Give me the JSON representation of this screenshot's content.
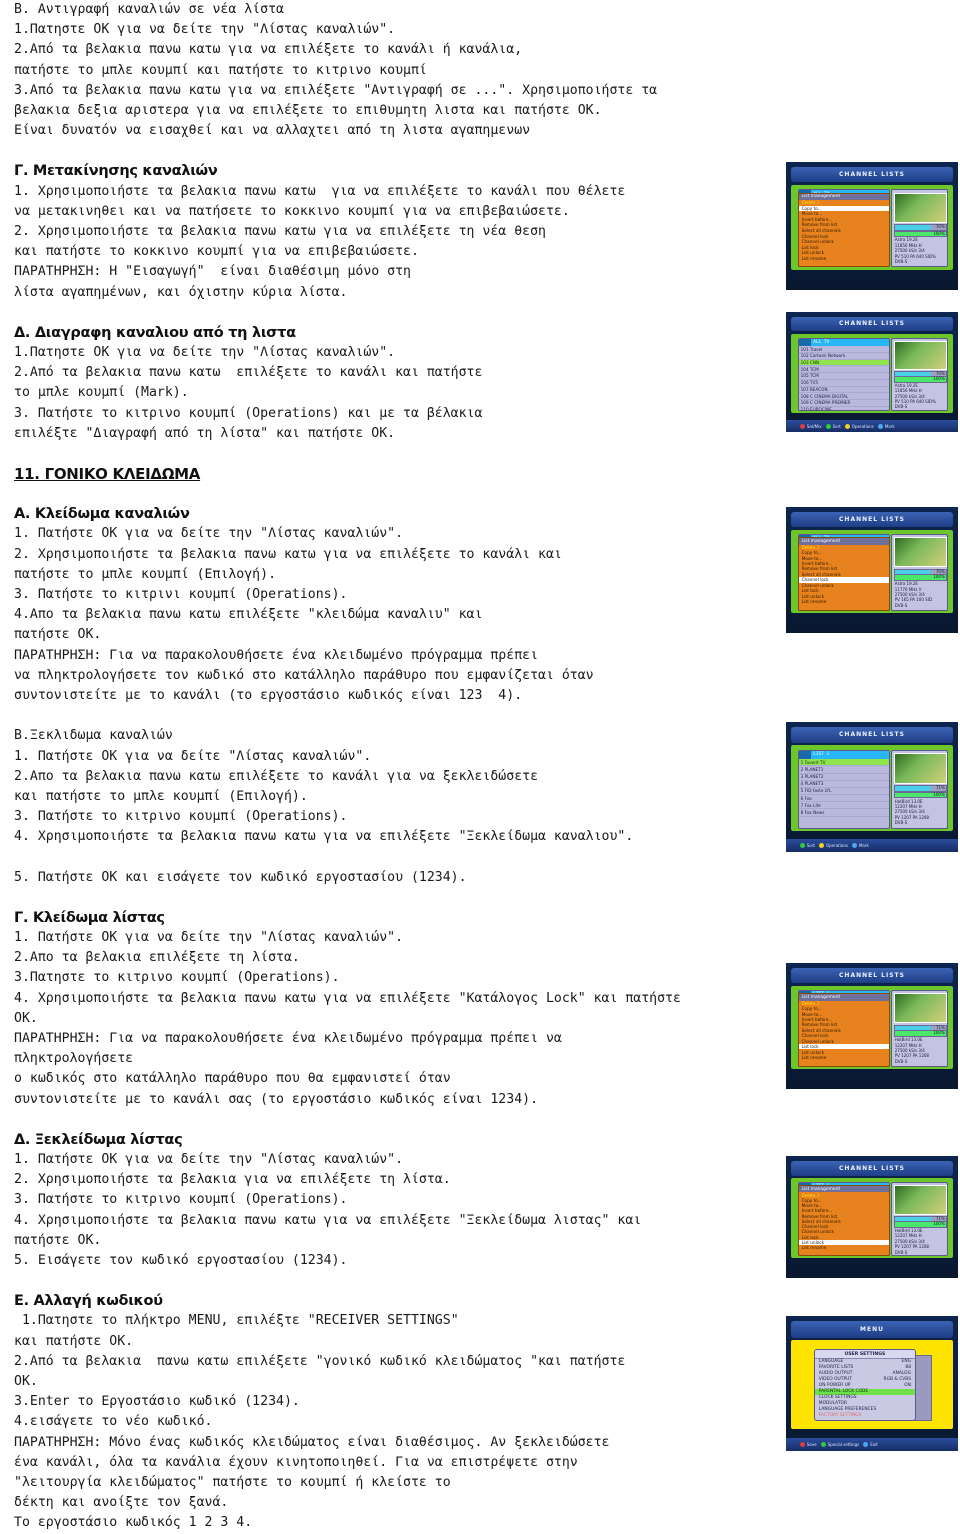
{
  "document": {
    "blocks": [
      {
        "type": "para",
        "text": "B. Αντιγραφή καναλιών σε νέα λίστα\n1.Πατηστε OK για να δείτε την \"Λίστας καναλιών\".\n2.Από τα βελακια πανω κατω για να επιλέξετε το κανάλι ή κανάλια,\nπατήστε το μπλε κουμπί και πατήστε το κιτρινο κουμπί\n3.Από τα βελακια πανω κατω για να επιλέξετε \"Αντιγραφή σε ...\". Χρησιμοποιήστε τα\nβελακια δεξια αριστερα για να επιλέξετε το επιθυμητη λιστα και πατήστε OK.\nΕίναι δυνατόν να εισαχθεί και να αλλαχτει από τη λιστα αγαπημενων"
      },
      {
        "type": "spacer"
      },
      {
        "type": "heading",
        "text": "Γ. Μετακίνησης καναλιών"
      },
      {
        "type": "para",
        "text": "1. Χρησιμοποιήστε τα βελακια πανω κατω  για να επιλέξετε το κανάλι που θέλετε\nνα μετακινηθει και να πατήσετε το κοκκινο κουμπί για να επιβεβαιώσετε.\n2. Χρησιμοποιήστε τα βελακια πανω κατω για να επιλέξετε τη νέα θεση\nκαι πατήστε το κοκκινο κουμπί για να επιβεβαιώσετε.\nΠΑΡΑΤΗΡΗΣΗ: Η \"Εισαγωγή\"  είναι διαθέσιμη μόνο στη\nλίστα αγαπημένων, και όχιστην κύρια λίστα."
      },
      {
        "type": "spacer"
      },
      {
        "type": "heading",
        "text": "Δ. Διαγραφη καναλιου από τη λιστα"
      },
      {
        "type": "para",
        "text": "1.Πατηστε OK για να δείτε την \"Λίστας καναλιών\".\n2.Από τα βελακια πανω κατω  επιλέξετε το κανάλι και πατήστε\nτο μπλε κουμπί (Mark).\n3. Πατήστε το κιτρινο κουμπί (Operations) και με τα βέλακια\nεπιλέξτε \"Διαγραφή από τη λίστα\" και πατήστε OK."
      },
      {
        "type": "spacer"
      },
      {
        "type": "heading",
        "numbered": true,
        "text": "11. ΓΟΝΙΚΟ ΚΛΕΙΔΩΜΑ"
      },
      {
        "type": "spacer"
      },
      {
        "type": "heading",
        "text": "Α. Κλείδωμα καναλιών"
      },
      {
        "type": "para",
        "text": "1. Πατήστε OK για να δείτε την \"Λίστας καναλιών\".\n2. Χρησιμοποιήστε τα βελακια πανω κατω για να επιλέξετε το κανάλι και\nπατήστε το μπλε κουμπί (Επιλογή).\n3. Πατήστε το κιτρινι κουμπί (Operations).\n4.Απο τα βελακια πανω κατω επιλέξετε \"κλειδώμα καναλιυ\" και\nπατήστε OK.\nΠΑΡΑΤΗΡΗΣΗ: Για να παρακολουθήσετε ένα κλειδωμένο πρόγραμμα πρέπει\nνα πληκτρολογήσετε τον κωδικό στο κατάλληλο παράθυρο που εμφανίζεται όταν\nσυντονιστείτε με το κανάλι (το εργοστάσιο κωδικός είναι 123  4)."
      },
      {
        "type": "spacer"
      },
      {
        "type": "para",
        "text": "B.Ξεκλιδωμα καναλιών\n1. Πατήστε OK για να δείτε \"Λίστας καναλιών\".\n2.Απο τα βελακια πανω κατω επιλέξετε το κανάλι για να ξεκλειδώσετε\nκαι πατήστε το μπλε κουμπί (Επιλογή).\n3. Πατήστε το κιτρινο κουμπί (Operations).\n4. Χρησιμοποιήστε τα βελακια πανω κατω για να επιλέξετε \"Ξεκλείδωμα καναλιου\"."
      },
      {
        "type": "spacer"
      },
      {
        "type": "para",
        "text": "5. Πατήστε OK και εισάγετε τον κωδικό εργοστασίου (1234)."
      },
      {
        "type": "spacer"
      },
      {
        "type": "heading",
        "text": "Γ. Κλείδωμα λίστας"
      },
      {
        "type": "para",
        "text": "1. Πατήστε OK για να δείτε την \"Λίστας καναλιών\".\n2.Απο τα βελακια επιλέξετε τη λίστα.\n3.Πατηστε το κιτρινο κουμπί (Operations).\n4. Χρησιμοποιήστε τα βελακια πανω κατω για να επιλέξετε \"Κατάλογος Lock\" και πατήστε\nOK.\nΠΑΡΑΤΗΡΗΣΗ: Για να παρακολουθήσετε ένα κλειδωμένο πρόγραμμα πρέπει να\nπληκτρολογήσετε\nο κωδικός στο κατάλληλο παράθυρο που θα εμφανιστεί όταν\nσυντονιστείτε με το κανάλι σας (το εργοστάσιο κωδικός είναι 1234)."
      },
      {
        "type": "spacer"
      },
      {
        "type": "heading",
        "text": "Δ. Ξεκλείδωμα λίστας"
      },
      {
        "type": "para",
        "text": "1. Πατήστε OK για να δείτε την \"Λίστας καναλιών\".\n2. Χρησιμοποιήστε τα βελακια για να επιλέξετε τη λίστα.\n3. Πατήστε το κιτρινο κουμπί (Operations).\n4. Χρησιμοποιήστε τα βελακια πανω κατω για να επιλέξετε \"Ξεκλείδωμα λιστας\" και\nπατήστε OK.\n5. Εισάγετε τον κωδικό εργοστασίου (1234)."
      },
      {
        "type": "spacer"
      },
      {
        "type": "heading",
        "text": "Ε. Αλλαγή κωδικού"
      },
      {
        "type": "para",
        "text": " 1.Πατηστε το πλήκτρο MENU, επιλέξτε \"RECEIVER SETTINGS\"\nκαι πατήστε OK.\n2.Από τα βελακια  πανω κατω επιλέξετε \"γονικό κωδικό κλειδώματος \"και πατήστε\nOK.\n3.Enter το Εργοστάσιο κωδικό (1234).\n4.εισάγετε το νέο κωδικό.\nΠΑΡΑΤΗΡΗΣΗ: Μόνο ένας κωδικός κλειδώματος είναι διαθέσιμος. Αν ξεκλειδώσετε\nένα κανάλι, όλα τα κανάλια έχουν κινητοποιηθεί. Για να επιστρέψετε στην\n\"λειτουργία κλειδώματος\" πατήστε το κουμπί ή κλείστε το\nδέκτη και ανοίξτε τον ξανά.\nΤο εργοστάσιο κωδικός 1 2 3 4."
      }
    ]
  },
  "screenshots": [
    {
      "id": "shot-copy-to",
      "title": "CHANNEL LISTS",
      "kind": "operations-menu",
      "list_header": "ALL TV",
      "menu_header": "List management",
      "menu_items": [
        {
          "label": "Delete 1",
          "style": "y"
        },
        {
          "label": "Copy to...",
          "style": "white"
        },
        {
          "label": "Move to...",
          "style": "n"
        },
        {
          "label": "Insert before...",
          "style": "n"
        },
        {
          "label": "Remove from list",
          "style": "n"
        },
        {
          "label": "Select all channels",
          "style": "n"
        },
        {
          "label": "Channel lock",
          "style": "n"
        },
        {
          "label": "Channel unlock",
          "style": "n"
        },
        {
          "label": "List lock",
          "style": "n"
        },
        {
          "label": "List unlock",
          "style": "n"
        },
        {
          "label": "List rename",
          "style": "n"
        }
      ],
      "signal": {
        "s_label": "S",
        "s_value": "70%",
        "q_label": "Q",
        "q_value": "100%"
      },
      "info": "Astra 19.2E\n11856 MHz H\n27500 kS/s 3/4\nPV 510 PA 640 SID%\nDVB-S",
      "footer": []
    },
    {
      "id": "shot-channel-list",
      "title": "CHANNEL LISTS",
      "kind": "plain-list",
      "list_header": "ALL TV",
      "rows": [
        {
          "num": "101",
          "label": "Travel",
          "sel": false
        },
        {
          "num": "102",
          "label": "Cartoon Network",
          "sel": false
        },
        {
          "num": "103",
          "label": "CNN",
          "sel": true
        },
        {
          "num": "104",
          "label": "TCM",
          "sel": false
        },
        {
          "num": "105",
          "label": "TCM",
          "sel": false
        },
        {
          "num": "106",
          "label": "TV5",
          "sel": false
        },
        {
          "num": "107",
          "label": "BEACON",
          "sel": false
        },
        {
          "num": "108",
          "label": "C CINEMA DIGITAL",
          "sel": false
        },
        {
          "num": "109",
          "label": "C CINEMA PREMIER",
          "sel": false
        },
        {
          "num": "110",
          "label": "EUROCINE",
          "sel": false
        }
      ],
      "signal": {
        "s_label": "S",
        "s_value": "70%",
        "q_label": "Q",
        "q_value": "100%"
      },
      "info": "Astra 19.2E\n11856 MHz H\n27500 kS/s 3/4\nPV 510 PA 640 SID%\nDVB-S",
      "footer": [
        {
          "color": "#e23b3b",
          "label": "Sat/Mix"
        },
        {
          "color": "#2ecb3f",
          "label": "Sort"
        },
        {
          "color": "#f2d021",
          "label": "Operations"
        },
        {
          "color": "#4aa8f0",
          "label": "Mark"
        }
      ]
    },
    {
      "id": "shot-channel-lock",
      "title": "CHANNEL LISTS",
      "kind": "operations-menu",
      "list_header": "ALL TV",
      "menu_header": "List management",
      "menu_items": [
        {
          "label": "Delete 1",
          "style": "y"
        },
        {
          "label": "Copy to...",
          "style": "n"
        },
        {
          "label": "Move to...",
          "style": "n"
        },
        {
          "label": "Insert before...",
          "style": "n"
        },
        {
          "label": "Remove from list",
          "style": "n"
        },
        {
          "label": "Select all channels",
          "style": "n"
        },
        {
          "label": "Channel lock",
          "style": "white"
        },
        {
          "label": "Channel unlock",
          "style": "n"
        },
        {
          "label": "List lock",
          "style": "n"
        },
        {
          "label": "List unlock",
          "style": "n"
        },
        {
          "label": "List rename",
          "style": "n"
        }
      ],
      "signal": {
        "s_label": "S",
        "s_value": "70%",
        "q_label": "Q",
        "q_value": "100%"
      },
      "info": "Astra 19.2E\n11776 MHz V\n27500 kS/s 3/4\nPV 165 PA 100 SID.\nDVB-S",
      "footer": []
    },
    {
      "id": "shot-list-channels",
      "title": "CHANNEL LISTS",
      "kind": "plain-list",
      "list_header": "LIST 1",
      "rows": [
        {
          "num": "1",
          "label": "Favorit TV",
          "sel": true
        },
        {
          "num": "2",
          "label": "PLANET1",
          "sel": false
        },
        {
          "num": "3",
          "label": "PLANET2",
          "sel": false
        },
        {
          "num": "4",
          "label": "PLANET3",
          "sel": false
        },
        {
          "num": "5",
          "label": "FID taste LYL",
          "sel": false
        },
        {
          "num": "6",
          "label": "Fox",
          "sel": false
        },
        {
          "num": "7",
          "label": "Fox Life",
          "sel": false
        },
        {
          "num": "8",
          "label": "Fox News",
          "sel": false
        }
      ],
      "signal": {
        "s_label": "S",
        "s_value": "71%",
        "q_label": "Q",
        "q_value": "100%"
      },
      "info": "HotBird 13.0E\n12207 MHz H\n27500 kS/s 3/4\nPV 1207 PA 1208\nDVB-S",
      "footer": [
        {
          "color": "#2ecb3f",
          "label": "Sort"
        },
        {
          "color": "#f2d021",
          "label": "Operations"
        },
        {
          "color": "#4aa8f0",
          "label": "Mark"
        }
      ]
    },
    {
      "id": "shot-list-lock",
      "title": "CHANNEL LISTS",
      "kind": "operations-menu",
      "list_header": "LIST 1",
      "menu_header": "List management",
      "menu_items": [
        {
          "label": "Delete 1",
          "style": "y"
        },
        {
          "label": "Copy to...",
          "style": "n"
        },
        {
          "label": "Move to...",
          "style": "n"
        },
        {
          "label": "Insert before...",
          "style": "n"
        },
        {
          "label": "Remove from list",
          "style": "n"
        },
        {
          "label": "Select all channels",
          "style": "n"
        },
        {
          "label": "Channel lock",
          "style": "n"
        },
        {
          "label": "Channel unlock",
          "style": "n"
        },
        {
          "label": "List lock",
          "style": "white"
        },
        {
          "label": "List unlock",
          "style": "n"
        },
        {
          "label": "List rename",
          "style": "n"
        }
      ],
      "signal": {
        "s_label": "S",
        "s_value": "71%",
        "q_label": "Q",
        "q_value": "100%"
      },
      "info": "HotBird 13.0E\n12207 MHz H\n27500 kS/s 3/4\nPV 1207 PA 1208\nDVB-S",
      "footer": []
    },
    {
      "id": "shot-list-unlock",
      "title": "CHANNEL LISTS",
      "kind": "operations-menu",
      "list_header": "LIST 1",
      "menu_header": "List management",
      "menu_items": [
        {
          "label": "Delete 1",
          "style": "y"
        },
        {
          "label": "Copy to...",
          "style": "n"
        },
        {
          "label": "Move to...",
          "style": "n"
        },
        {
          "label": "Insert before...",
          "style": "n"
        },
        {
          "label": "Remove from list",
          "style": "n"
        },
        {
          "label": "Select all channels",
          "style": "n"
        },
        {
          "label": "Channel lock",
          "style": "n"
        },
        {
          "label": "Channel unlock",
          "style": "n"
        },
        {
          "label": "List lock",
          "style": "n"
        },
        {
          "label": "List unlock",
          "style": "white"
        },
        {
          "label": "List rename",
          "style": "n"
        }
      ],
      "signal": {
        "s_label": "S",
        "s_value": "71%",
        "q_label": "Q",
        "q_value": "100%"
      },
      "info": "HotBird 13.0E\n12207 MHz H\n27500 kS/s 3/4\nPV 1207 PA 1208\nDVB-S",
      "footer": []
    }
  ],
  "menu_screenshot": {
    "id": "shot-user-settings",
    "title": "MENU",
    "panel_title": "USER SETTINGS",
    "rows": [
      {
        "label": "LANGUAGE",
        "value": "ENG",
        "style": "n"
      },
      {
        "label": "FAVORITE LISTS",
        "value": "88",
        "style": "n"
      },
      {
        "label": "AUDIO OUTPUT",
        "value": "ANALOG",
        "style": "n"
      },
      {
        "label": "VIDEO OUTPUT",
        "value": "RGB & CVBS",
        "style": "n"
      },
      {
        "label": "ON POWER UP",
        "value": "ON",
        "style": "n"
      },
      {
        "label": "PARENTAL LOCK CODE",
        "value": "",
        "style": "sel"
      },
      {
        "label": "CLOCK SETTINGS",
        "value": "",
        "style": "n"
      },
      {
        "label": "MODULATOR",
        "value": "",
        "style": "n"
      },
      {
        "label": "LANGUAGE PREFERENCES",
        "value": "",
        "style": "n"
      },
      {
        "label": "FACTORY SETTINGS",
        "value": "",
        "style": "red"
      }
    ],
    "footer": [
      {
        "color": "#e23b3b",
        "label": "Save"
      },
      {
        "color": "#2ecb3f",
        "label": "Special settings"
      },
      {
        "color": "#4aa8f0",
        "label": "Exit"
      }
    ]
  }
}
